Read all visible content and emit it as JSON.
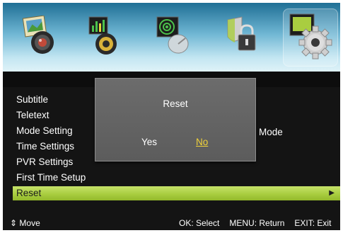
{
  "tabs": [
    {
      "icon": "picture-camera-icon"
    },
    {
      "icon": "sound-speaker-icon"
    },
    {
      "icon": "channel-satellite-icon"
    },
    {
      "icon": "lock-icon"
    },
    {
      "icon": "gear-settings-icon",
      "selected": true
    }
  ],
  "menu": {
    "items": [
      "Subtitle",
      "Teletext",
      "Mode Setting",
      "Time Settings",
      "PVR Settings",
      "First Time Setup",
      "Reset"
    ],
    "selected_index": 6,
    "partial_label": "Mode"
  },
  "dialog": {
    "title": "Reset",
    "yes_label": "Yes",
    "no_label": "No",
    "focused": "No"
  },
  "footer": {
    "move": "Move",
    "select": "OK: Select",
    "return": "MENU: Return",
    "exit": "EXIT: Exit"
  },
  "colors": {
    "selection_bar": "#a9cd40",
    "dialog_focus": "#f0d23a",
    "dialog_bg": "#666666"
  }
}
